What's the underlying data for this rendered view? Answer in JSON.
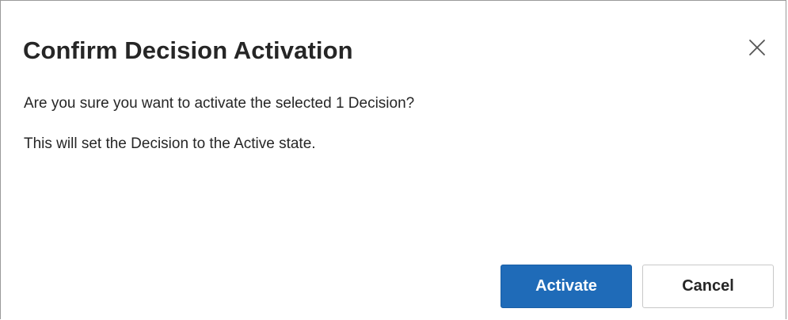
{
  "dialog": {
    "title": "Confirm Decision Activation",
    "message_line1": "Are you sure you want to activate the selected 1 Decision?",
    "message_line2": "This will set the Decision to the Active state.",
    "close_icon": "close-icon"
  },
  "actions": {
    "activate_label": "Activate",
    "cancel_label": "Cancel"
  },
  "colors": {
    "primary_button": "#1f6bb8",
    "text": "#262626"
  }
}
